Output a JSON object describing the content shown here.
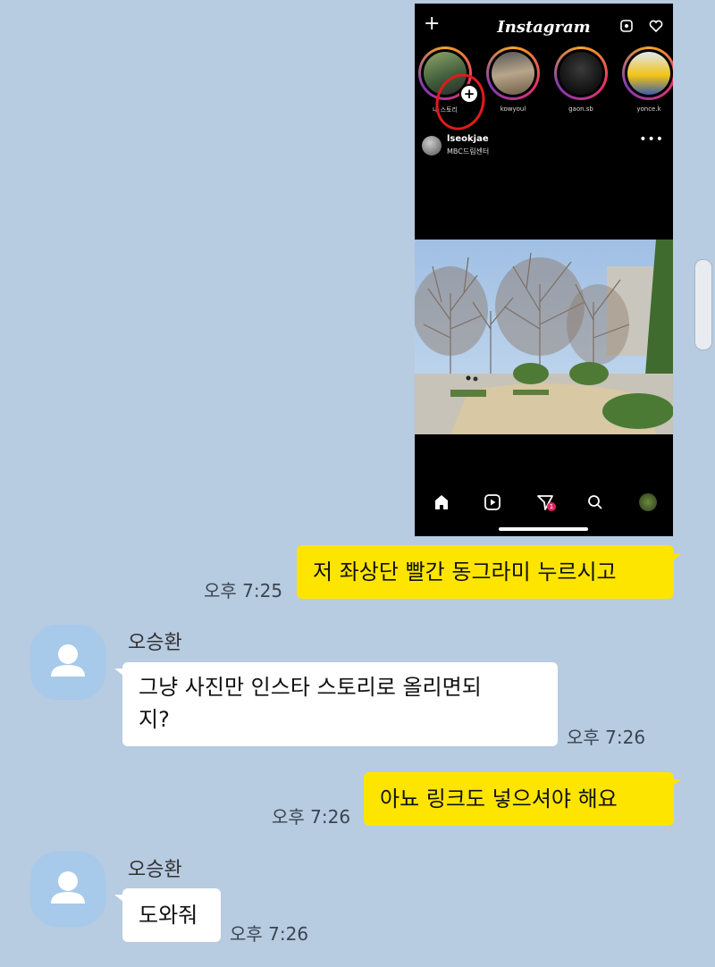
{
  "shared_image": {
    "app_title": "Instagram",
    "stories": [
      {
        "name": "내 스토리"
      },
      {
        "name": "kowyoul"
      },
      {
        "name": "gaon.sb"
      },
      {
        "name": "yonce.k"
      }
    ],
    "post": {
      "username": "lseokjae",
      "location": "MBC드림센터"
    },
    "nav_badge": "1",
    "colors": {
      "annotation": "#e01b1b"
    }
  },
  "messages": [
    {
      "sender": "me",
      "text": "저 좌상단 빨간 동그라미 누르시고",
      "time": "오후 7:25"
    },
    {
      "sender": "오승환",
      "text_line1": "그냥 사진만 인스타  스토리로 올리면되",
      "text_line2": "지?",
      "time": "오후 7:26"
    },
    {
      "sender": "me",
      "text": "아뇨 링크도 넣으셔야 해요",
      "time": "오후 7:26"
    },
    {
      "sender": "오승환",
      "text": "도와줘",
      "time": "오후 7:26"
    }
  ],
  "colors": {
    "chat_bg": "#b7cbe1",
    "my_bubble": "#fee500",
    "other_bubble": "#ffffff",
    "avatar_bg": "#a7c9ea"
  }
}
